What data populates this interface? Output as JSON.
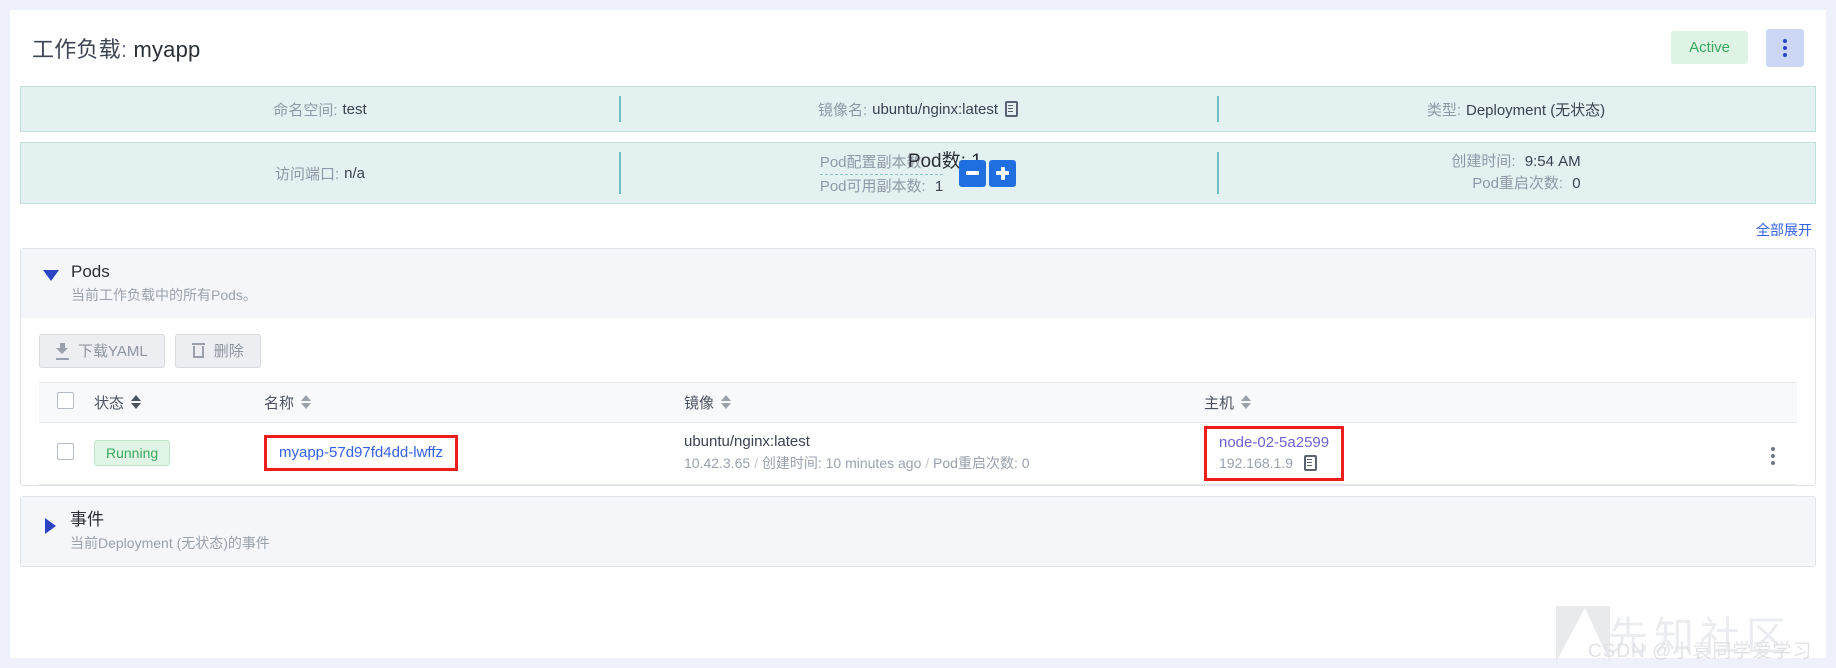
{
  "header": {
    "title_label": "工作负载",
    "title_sep": ":",
    "title_value": "myapp",
    "status_badge": "Active",
    "kebab_name": "more-actions"
  },
  "info_bar_1": [
    {
      "label": "命名空间:",
      "value": "test",
      "icon": null
    },
    {
      "label": "镜像名:",
      "value": "ubuntu/nginx:latest",
      "icon": "copy-icon"
    },
    {
      "label": "类型:",
      "value": "Deployment (无状态)",
      "icon": null
    }
  ],
  "info_bar_2": {
    "ports": {
      "label": "访问端口:",
      "value": "n/a"
    },
    "replicas": {
      "configured_label": "Pod配置副本数:",
      "configured_value": "",
      "available_label": "Pod可用副本数:",
      "available_value": "1",
      "tooltip_label": "Pod数:",
      "tooltip_value": "1",
      "decrease_label": "−",
      "increase_label": "+"
    },
    "created": {
      "label": "创建时间:",
      "value": "9:54 AM",
      "restarts_label": "Pod重启次数:",
      "restarts_value": "0"
    }
  },
  "expand_all": "全部展开",
  "pods_section": {
    "title": "Pods",
    "subtitle": "当前工作负载中的所有Pods。",
    "toolbar": {
      "download_yaml": "下载YAML",
      "delete": "删除"
    },
    "columns": [
      {
        "key": "status",
        "label": "状态",
        "sorted": true
      },
      {
        "key": "name",
        "label": "名称",
        "sorted": false
      },
      {
        "key": "image",
        "label": "镜像",
        "sorted": false
      },
      {
        "key": "host",
        "label": "主机",
        "sorted": false
      }
    ],
    "rows": [
      {
        "status": "Running",
        "name": "myapp-57d97fd4dd-lwffz",
        "image": "ubuntu/nginx:latest",
        "image_ip": "10.42.3.65",
        "image_sep1": "/",
        "image_created_label": "创建时间:",
        "image_created_value": "10 minutes ago",
        "image_sep2": "/",
        "image_restarts_label": "Pod重启次数:",
        "image_restarts_value": "0",
        "host_name": "node-02-5a2599",
        "host_ip": "192.168.1.9"
      }
    ]
  },
  "events_section": {
    "title": "事件",
    "subtitle": "当前Deployment (无状态)的事件"
  },
  "watermark": {
    "cn": "先知社区",
    "csdn": "CSDN @小袁同学爱学习"
  },
  "colors": {
    "accent_blue": "#3560e8",
    "badge_green_text": "#3aa860",
    "badge_green_bg": "#dff3e4",
    "infobar_bg": "#e3f2f1",
    "highlight_red": "#ef1c1c",
    "stepper_blue": "#1f6fe0"
  }
}
